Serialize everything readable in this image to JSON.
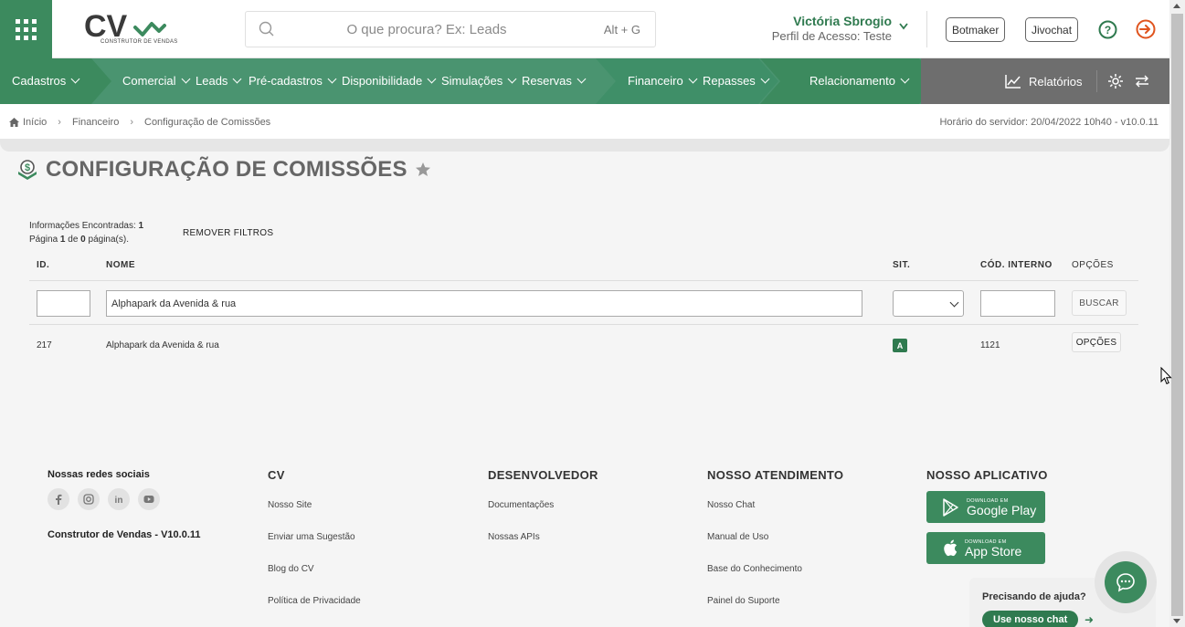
{
  "header": {
    "logo_text": "CV",
    "logo_subtitle": "CONSTRUTOR DE VENDAS",
    "search_placeholder": "O que procura? Ex: Leads",
    "search_shortcut": "Alt + G",
    "user_name": "Victória Sbrogio",
    "user_profile": "Perfil de Acesso: Teste",
    "btn_botmaker": "Botmaker",
    "btn_jivochat": "Jivochat"
  },
  "nav": {
    "items": [
      {
        "label": "Cadastros"
      },
      {
        "label": "Comercial"
      },
      {
        "label": "Leads"
      },
      {
        "label": "Pré-cadastros"
      },
      {
        "label": "Disponibilidade"
      },
      {
        "label": "Simulações"
      },
      {
        "label": "Reservas"
      },
      {
        "label": "Financeiro"
      },
      {
        "label": "Repasses"
      },
      {
        "label": "Relacionamento"
      }
    ],
    "reports": "Relatórios"
  },
  "breadcrumb": {
    "home": "Início",
    "level1": "Financeiro",
    "level2": "Configuração de Comissões",
    "server_time": "Horário do servidor: 20/04/2022 10h40 - v10.0.11"
  },
  "page": {
    "title": "CONFIGURAÇÃO DE COMISSÕES",
    "info_found_label": "Informações Encontradas:",
    "info_found_value": "1",
    "page_word": "Página",
    "page_current": "1",
    "page_of": "de",
    "page_total": "0",
    "page_suffix": "página(s).",
    "remove_filters": "REMOVER FILTROS"
  },
  "table": {
    "headers": {
      "id": "ID.",
      "name": "NOME",
      "sit": "SIT.",
      "code": "CÓD. INTERNO",
      "options": "OPÇÕES"
    },
    "filters": {
      "id": "",
      "name": "Alphapark da Avenida & rua",
      "code": "",
      "search_button": "BUSCAR"
    },
    "rows": [
      {
        "id": "217",
        "name": "Alphapark da Avenida & rua",
        "sit": "A",
        "code": "1121",
        "options": "OPÇÕES"
      }
    ]
  },
  "footer": {
    "social_title": "Nossas redes sociais",
    "version": "Construtor de Vendas - V10.0.11",
    "cv": {
      "title": "CV",
      "links": [
        "Nosso Site",
        "Enviar uma Sugestão",
        "Blog do CV",
        "Política de Privacidade"
      ]
    },
    "dev": {
      "title": "DESENVOLVEDOR",
      "links": [
        "Documentações",
        "Nossas APIs"
      ]
    },
    "support": {
      "title": "NOSSO ATENDIMENTO",
      "links": [
        "Nosso Chat",
        "Manual de Uso",
        "Base do Conhecimento",
        "Painel do Suporte"
      ]
    },
    "app": {
      "title": "NOSSO APLICATIVO",
      "google_small": "DOWNLOAD EM",
      "google_big": "Google Play",
      "apple_small": "DOWNLOAD EM",
      "apple_big": "App Store"
    }
  },
  "help": {
    "question": "Precisando de ajuda?",
    "button": "Use nosso chat"
  },
  "colors": {
    "brand_green": "#3c8a5e",
    "nav_green": "#4a9470",
    "nav_gray": "#6e6e6e",
    "exit_red": "#e0541e"
  }
}
